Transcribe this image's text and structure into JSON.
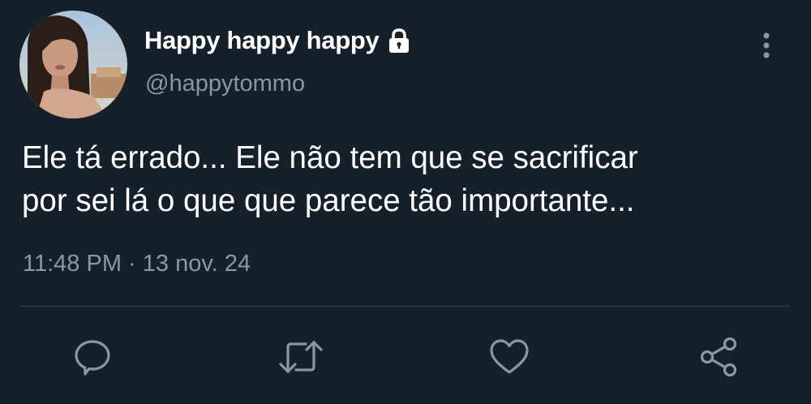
{
  "tweet": {
    "author": {
      "display_name": "Happy happy happy",
      "handle": "@happytommo",
      "protected_icon": "lock-icon",
      "avatar": "profile-photo"
    },
    "text_lines": [
      "Ele tá errado... Ele não tem que se sacrificar",
      "por sei lá o que que parece tão importante..."
    ],
    "time": "11:48 PM",
    "separator": "·",
    "date": "13 nov. 24",
    "menu_icon": "more-vertical-icon",
    "actions": [
      {
        "name": "reply",
        "icon": "reply-icon"
      },
      {
        "name": "retweet",
        "icon": "retweet-icon"
      },
      {
        "name": "like",
        "icon": "heart-icon"
      },
      {
        "name": "share",
        "icon": "share-icon"
      }
    ]
  },
  "colors": {
    "background": "#15202b",
    "primary_text": "#ffffff",
    "secondary_text": "#8899a6",
    "divider": "#38444d",
    "icon": "#8899a6"
  }
}
